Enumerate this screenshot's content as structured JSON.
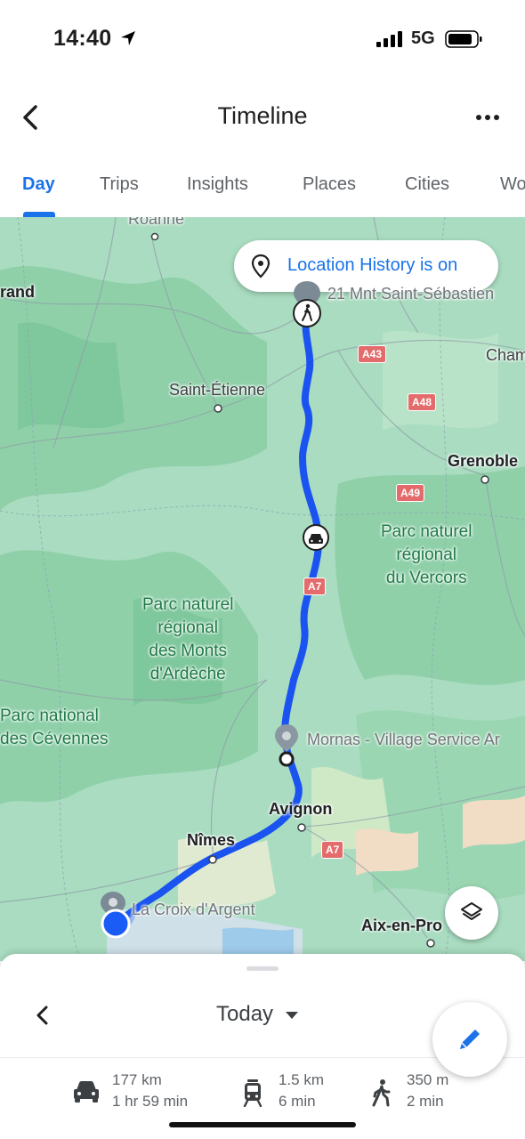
{
  "status_bar": {
    "time": "14:40",
    "network": "5G"
  },
  "header": {
    "title": "Timeline"
  },
  "tabs": [
    {
      "label": "Day",
      "active": true
    },
    {
      "label": "Trips"
    },
    {
      "label": "Insights"
    },
    {
      "label": "Places"
    },
    {
      "label": "Cities"
    },
    {
      "label": "Wo"
    }
  ],
  "map": {
    "history_pill": "Location History is on",
    "labels": {
      "roanne": "Roanne",
      "rand": "rand",
      "st_sebastien": "21 Mnt Saint-Sébastien",
      "cham": "Cham",
      "saint_etienne": "Saint-Étienne",
      "grenoble": "Grenoble",
      "vercors": "Parc naturel\nrégional\ndu Vercors",
      "ardeche": "Parc naturel\nrégional\ndes Monts\nd'Ardèche",
      "cevennes": "Parc national\ndes Cévennes",
      "mornas": "Mornas - Village Service Ar",
      "avignon": "Avignon",
      "nimes": "Nîmes",
      "croix": "La Croix d'Argent",
      "aix": "Aix-en-Pro"
    },
    "roads": {
      "a43": "A43",
      "a48": "A48",
      "a49": "A49",
      "a7_1": "A7",
      "a7_2": "A7"
    },
    "route_color": "#1a53f0",
    "park_color": "#1e7a47"
  },
  "sheet": {
    "date": "Today",
    "stats": [
      {
        "icon": "car-icon",
        "distance": "177 km",
        "duration": "1 hr 59 min"
      },
      {
        "icon": "tram-icon",
        "distance": "1.5 km",
        "duration": "6 min"
      },
      {
        "icon": "walk-icon",
        "distance": "350 m",
        "duration": "2 min"
      }
    ]
  },
  "colors": {
    "accent": "#1a73e8"
  }
}
